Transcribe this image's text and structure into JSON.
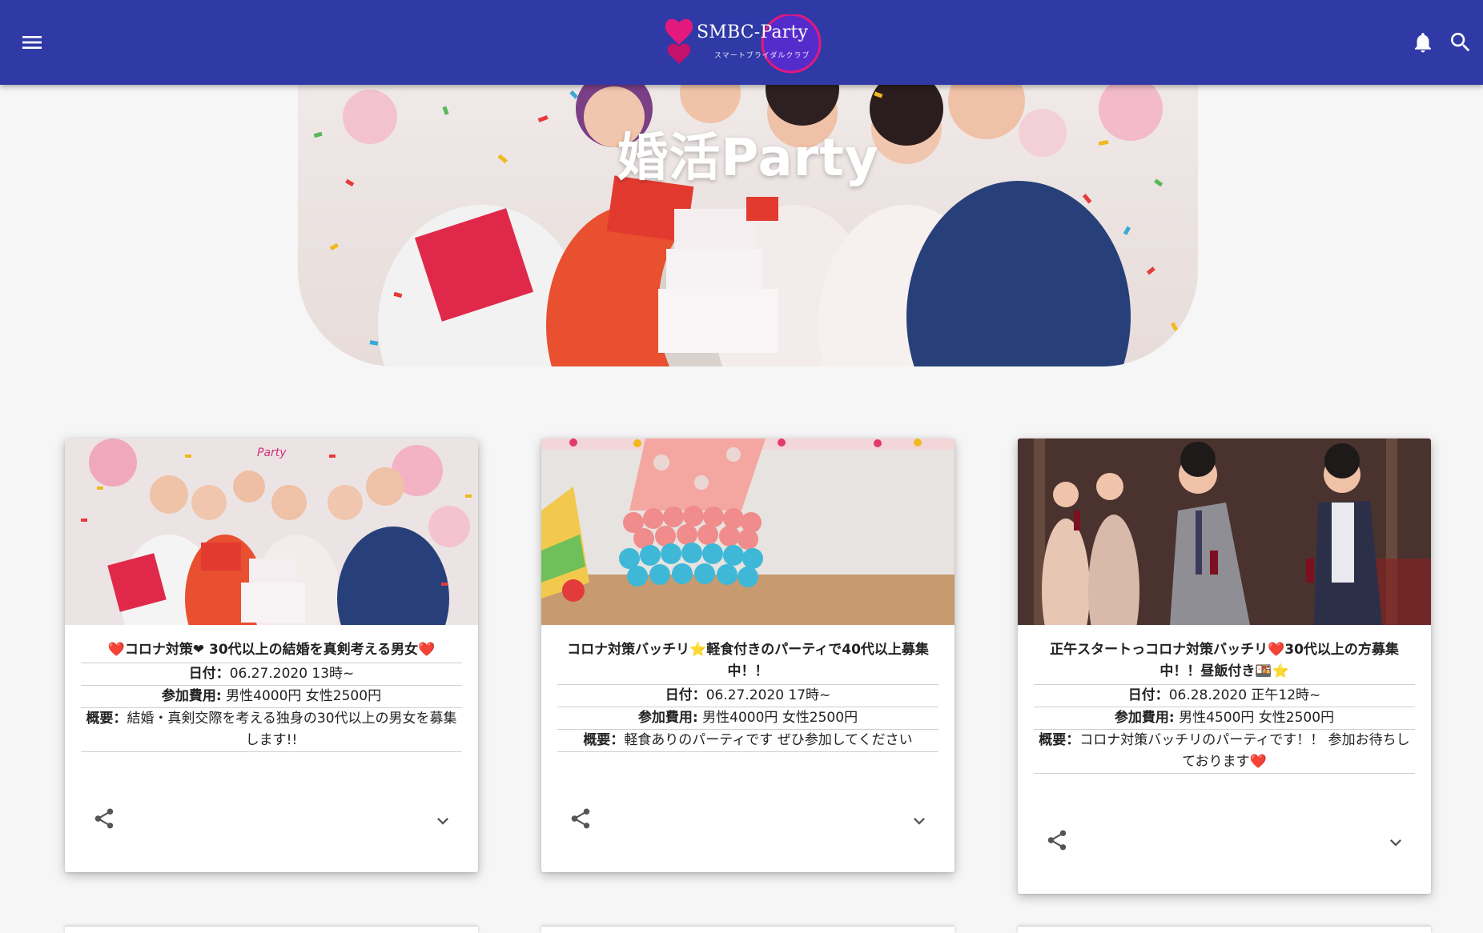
{
  "header": {
    "brand": "SMBC-Party",
    "tagline": "スマートブライダルクラブ"
  },
  "hero": {
    "title": "婚活Party"
  },
  "icons": {
    "menu": "menu-icon",
    "notifications": "bell-icon",
    "search": "search-icon",
    "share": "share-icon",
    "expand": "chevron-down-icon"
  },
  "colors": {
    "appbar": "#2f3aa6",
    "heart": "#e21d2c",
    "star": "#f4b400"
  },
  "cards": [
    {
      "title_heart_left": "❤️",
      "title": "コロナ対策❤ 30代以上の結婚を真剣考える男女",
      "title_heart_right": "❤️",
      "date_label": "日付：",
      "date_value": "06.27.2020 13時~",
      "fee_label": "参加費用:",
      "fee_value": " 男性4000円  女性2500円",
      "summary_label": "概要：",
      "summary_value": "結婚・真剣交際を考える独身の30代以上の男女を募集します!!"
    },
    {
      "title_a": "コロナ対策バッチリ",
      "title_star": "⭐",
      "title_b": "軽食付きのパーティで40代以上募集中！！",
      "date_label": "日付：",
      "date_value": "06.27.2020 17時~",
      "fee_label": "参加費用:",
      "fee_value": " 男性4000円  女性2500円",
      "summary_label": "概要：",
      "summary_value": "軽食ありのパーティです ぜひ参加してください"
    },
    {
      "title_a": "正午スタートっコロナ対策バッチリ",
      "title_heart": "❤️",
      "title_b": "30代以上の方募集中！！昼飯付き",
      "title_emoji": "🍱⭐",
      "date_label": "日付：",
      "date_value": "06.28.2020 正午12時~",
      "fee_label": "参加費用:",
      "fee_value": " 男性4500円  女性2500円",
      "summary_label": "概要：",
      "summary_value": "コロナ対策バッチリのパーティです！！ 参加お待ちしております",
      "summary_heart": "❤️"
    }
  ]
}
